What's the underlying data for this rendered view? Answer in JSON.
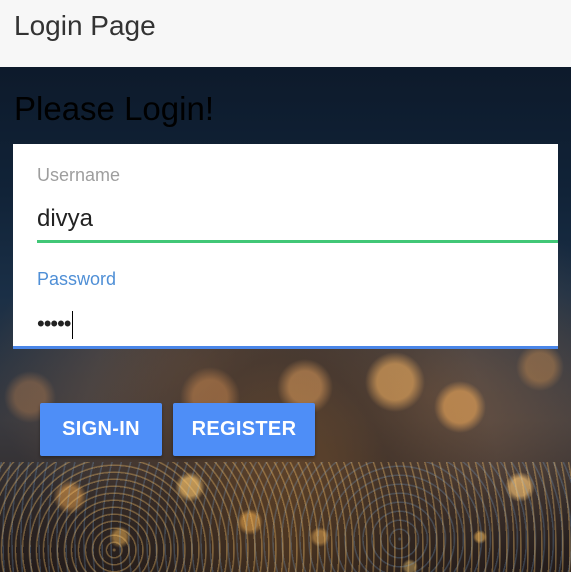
{
  "toolbar": {
    "title": "Login Page"
  },
  "main": {
    "heading": "Please Login!",
    "username_field": {
      "label": "Username",
      "value": "divya"
    },
    "password_field": {
      "label": "Password",
      "value_masked": "•••••"
    },
    "buttons": {
      "signin_label": "SIGN-IN",
      "register_label": "REGISTER"
    }
  },
  "colors": {
    "accent_blue": "#4e8ef7",
    "focus_blue": "#4a86e8",
    "valid_green": "#41c777",
    "toolbar_bg": "#f7f7f7"
  }
}
